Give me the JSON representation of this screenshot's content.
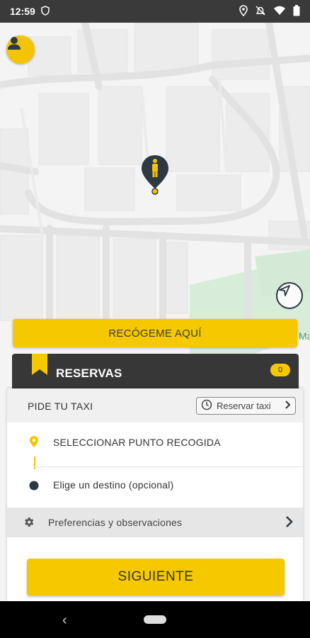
{
  "status_bar": {
    "time": "12:59"
  },
  "map": {
    "side_label": "Ma"
  },
  "pickup_here_button": "RECÓGEME AQUÍ",
  "reservas": {
    "title": "RESERVAS",
    "count": "0"
  },
  "panel": {
    "header_label": "PIDE TU TAXI",
    "reserve_button": "Reservar taxi",
    "pickup_label": "SELECCIONAR PUNTO RECOGIDA",
    "destination_label": "Elige un destino (opcional)",
    "preferences_label": "Preferencias y observaciones",
    "next_button": "SIGUIENTE"
  },
  "colors": {
    "accent": "#f5c800",
    "dark": "#373737",
    "pin": "#2e3842"
  }
}
